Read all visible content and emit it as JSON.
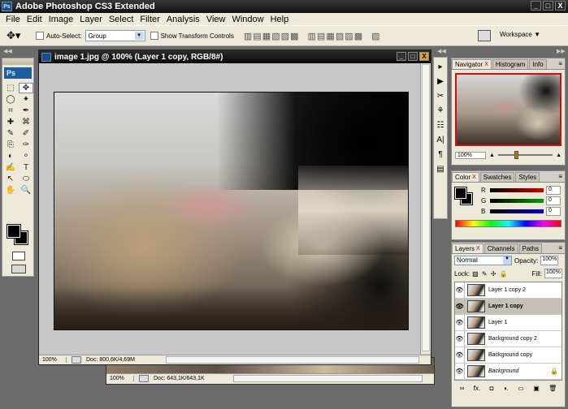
{
  "app": {
    "title": "Adobe Photoshop CS3 Extended",
    "logo": "Ps",
    "logo_mini": "Ps"
  },
  "window_controls": {
    "minimize": "_",
    "restore": "□",
    "close": "X"
  },
  "menu": [
    "File",
    "Edit",
    "Image",
    "Layer",
    "Select",
    "Filter",
    "Analysis",
    "View",
    "Window",
    "Help"
  ],
  "options": {
    "auto_select_label": "Auto-Select:",
    "auto_select_value": "Group",
    "show_transform_label": "Show Transform Controls",
    "align_icons": "▥ ▤ ▦ ▧ ▨ ▩",
    "distribute_icons": "▥ ▤ ▦ ▧ ▨ ▩",
    "arrange_icon": "▧",
    "workspace_label": "Workspace ▼"
  },
  "document": {
    "title": "image 1.jpg @ 100% (Layer 1 copy, RGB/8#)",
    "zoom": "100%",
    "doc_size": "Doc: 800,6K/4,69M"
  },
  "document_behind": {
    "zoom": "100%",
    "doc_size": "Doc: 643,1K/643,1K"
  },
  "navigator": {
    "tabs": [
      "Navigator",
      "Histogram",
      "Info"
    ],
    "zoom": "100%",
    "zoom_out_icon": "▲",
    "zoom_in_icon": "▲",
    "zoom_fraction": 0.3
  },
  "color": {
    "tabs": [
      "Color",
      "Swatches",
      "Styles"
    ],
    "channels": [
      {
        "label": "R",
        "value": "0",
        "color": "#d00000"
      },
      {
        "label": "G",
        "value": "0",
        "color": "#00a000"
      },
      {
        "label": "B",
        "value": "0",
        "color": "#0000d0"
      }
    ],
    "foreground": "#000000",
    "background": "#000000"
  },
  "layers": {
    "tabs": [
      "Layers",
      "Channels",
      "Paths"
    ],
    "blend_mode": "Normal",
    "opacity_label": "Opacity:",
    "opacity": "100%",
    "lock_label": "Lock:",
    "lock_icons": "▨ ✎ ✢ 🔒",
    "fill_label": "Fill:",
    "fill": "100%",
    "items": [
      {
        "name": "Layer 1 copy 2",
        "selected": false,
        "italic": false,
        "locked": false
      },
      {
        "name": "Layer 1 copy",
        "selected": true,
        "italic": false,
        "locked": false
      },
      {
        "name": "Layer 1",
        "selected": false,
        "italic": false,
        "locked": false
      },
      {
        "name": "Background copy 2",
        "selected": false,
        "italic": false,
        "locked": false
      },
      {
        "name": "Background copy",
        "selected": false,
        "italic": false,
        "locked": false
      },
      {
        "name": "Background",
        "selected": false,
        "italic": true,
        "locked": true
      }
    ],
    "lock_glyph": "🔒",
    "footer_icons": [
      "∞",
      "fx.",
      "◘",
      "◑.",
      "▭",
      "▣",
      "🗑"
    ]
  },
  "tools": [
    "⬚",
    "✥",
    "◯",
    "✦",
    "⌗",
    "✒",
    "✚",
    "⌘",
    "✎",
    "✐",
    "⎘",
    "✑",
    "◐",
    "⚬",
    "✍",
    "T",
    "↖",
    "⬭",
    "✋",
    "🔍"
  ],
  "icon_strip": [
    "▸",
    "▶",
    "✂",
    "⚘",
    "☷",
    "A|",
    "¶",
    "▤"
  ],
  "menu_glyph": "≡",
  "arrow_glyph": "▼",
  "eye_glyph": "👁",
  "dock_arrows": {
    "left": "◀◀",
    "right": "▶▶"
  }
}
